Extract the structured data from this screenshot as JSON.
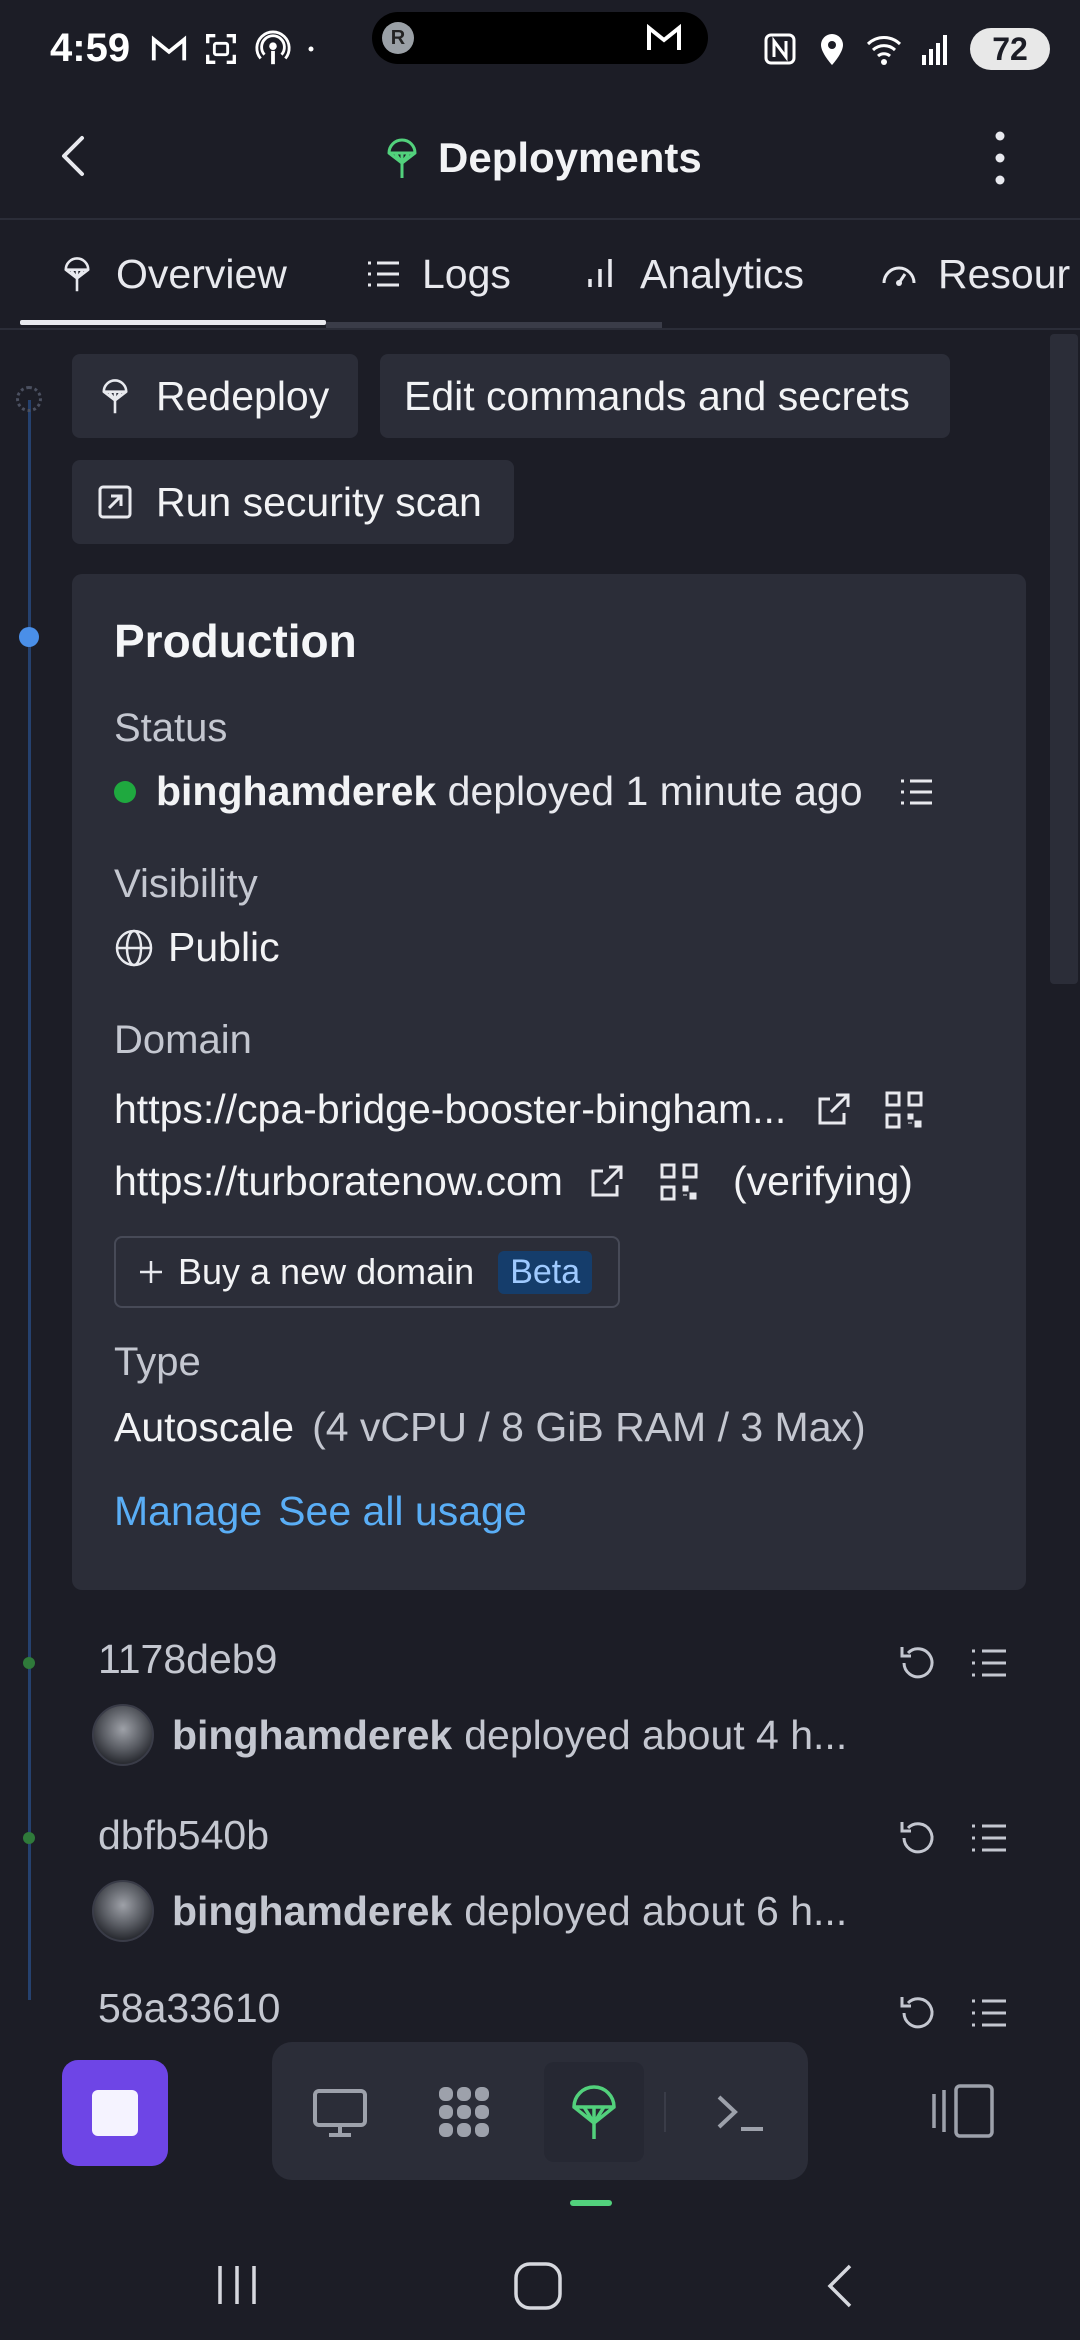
{
  "status_bar": {
    "time": "4:59",
    "notification_avatar_letter": "R",
    "battery": "72",
    "icons": [
      "gmail-icon",
      "screenshot-icon",
      "podcast-icon",
      "dot-icon",
      "nfc-icon",
      "location-icon",
      "wifi-icon",
      "signal-icon"
    ]
  },
  "header": {
    "title": "Deployments",
    "back_icon": "chevron-left-icon",
    "menu_icon": "more-vertical-icon"
  },
  "tabs": [
    {
      "label": "Overview",
      "icon": "deployments-icon",
      "active": true
    },
    {
      "label": "Logs",
      "icon": "list-icon",
      "active": false
    },
    {
      "label": "Analytics",
      "icon": "bar-chart-icon",
      "active": false
    },
    {
      "label": "Resour",
      "icon": "gauge-icon",
      "active": false
    }
  ],
  "actions": {
    "redeploy": "Redeploy",
    "edit": "Edit commands and secrets",
    "scan": "Run security scan"
  },
  "production": {
    "title": "Production",
    "status_label": "Status",
    "status_user": "binghamderek",
    "status_text": "deployed 1 minute ago",
    "visibility_label": "Visibility",
    "visibility_value": "Public",
    "domain_label": "Domain",
    "domain_1": "https://cpa-bridge-booster-bingham...",
    "domain_2": "https://turboratenow.com",
    "domain_2_state": "(verifying)",
    "buy_domain": "Buy a new domain",
    "buy_badge": "Beta",
    "type_label": "Type",
    "type_value": "Autoscale",
    "type_detail": "(4 vCPU / 8 GiB RAM / 3 Max)",
    "manage_link": "Manage",
    "usage_link": "See all usage",
    "status_color": "#1fa93f"
  },
  "history": [
    {
      "id": "1178deb9",
      "user": "binghamderek",
      "text": "deployed about 4 h..."
    },
    {
      "id": "dbfb540b",
      "user": "binghamderek",
      "text": "deployed about 6 h..."
    },
    {
      "id": "58a33610",
      "user": "",
      "text": ""
    }
  ],
  "colors": {
    "accent_purple": "#6e45e6",
    "link_blue": "#5aaef6",
    "active_green": "#52d17c"
  }
}
